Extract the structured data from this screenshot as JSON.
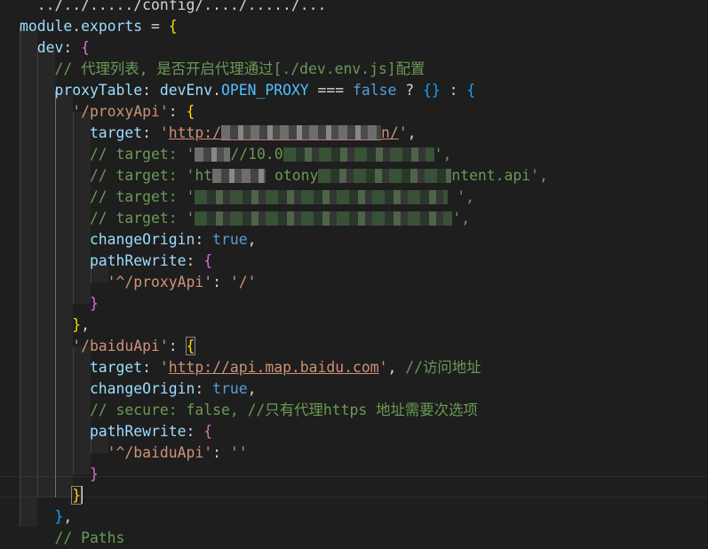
{
  "colors": {
    "keyword": "#569cd6",
    "variable": "#9cdcfe",
    "property": "#9cdcfe",
    "string": "#ce9178",
    "comment": "#6a9955",
    "constant": "#4fc1ff",
    "bracket1": "#ffd700",
    "bracket2": "#da70d6",
    "bracket3": "#179fff",
    "text": "#d4d4d4"
  },
  "lines": [
    {
      "tokens": [
        {
          "t": "  ",
          "c": "text"
        },
        {
          "t": "../../...../config/..../...../...",
          "c": "text"
        }
      ]
    },
    {
      "tokens": [
        {
          "t": "module",
          "c": "variable"
        },
        {
          "t": ".",
          "c": "text"
        },
        {
          "t": "exports",
          "c": "variable"
        },
        {
          "t": " = ",
          "c": "text"
        },
        {
          "t": "{",
          "c": "bracket1"
        }
      ]
    },
    {
      "tokens": [
        {
          "t": "  dev",
          "c": "property"
        },
        {
          "t": ": ",
          "c": "text"
        },
        {
          "t": "{",
          "c": "bracket2"
        }
      ]
    },
    {
      "tokens": [
        {
          "t": "    // 代理列表, 是否开启代理通过[./dev.env.js]配置",
          "c": "comment"
        }
      ]
    },
    {
      "tokens": [
        {
          "t": "    proxyTable",
          "c": "property"
        },
        {
          "t": ": ",
          "c": "text"
        },
        {
          "t": "devEnv",
          "c": "variable"
        },
        {
          "t": ".",
          "c": "text"
        },
        {
          "t": "OPEN_PROXY",
          "c": "constant"
        },
        {
          "t": " === ",
          "c": "text"
        },
        {
          "t": "false",
          "c": "keyword"
        },
        {
          "t": " ? ",
          "c": "text"
        },
        {
          "t": "{}",
          "c": "bracket3"
        },
        {
          "t": " : ",
          "c": "text"
        },
        {
          "t": "{",
          "c": "bracket3"
        }
      ]
    },
    {
      "tokens": [
        {
          "t": "      '/proxyApi'",
          "c": "string"
        },
        {
          "t": ": ",
          "c": "text"
        },
        {
          "t": "{",
          "c": "bracket1"
        }
      ]
    },
    {
      "tokens": [
        {
          "t": "        target",
          "c": "property"
        },
        {
          "t": ": ",
          "c": "text"
        },
        {
          "t": "'",
          "c": "string"
        },
        {
          "t": "http:/",
          "c": "string",
          "u": true
        },
        {
          "blur": 180,
          "k": "light",
          "u": true
        },
        {
          "t": "n/",
          "c": "string",
          "u": true
        },
        {
          "t": "'",
          "c": "string"
        },
        {
          "t": ",",
          "c": "text"
        }
      ]
    },
    {
      "tokens": [
        {
          "t": "        // target: '",
          "c": "comment"
        },
        {
          "blur": 40,
          "k": "light"
        },
        {
          "t": "//10.0",
          "c": "comment"
        },
        {
          "blur": 170,
          "k": "green"
        },
        {
          "t": "',",
          "c": "comment"
        }
      ]
    },
    {
      "tokens": [
        {
          "t": "        // target: 'ht",
          "c": "comment"
        },
        {
          "blur": 60,
          "k": "light"
        },
        {
          "t": " otony",
          "c": "comment"
        },
        {
          "blur": 150,
          "k": "green"
        },
        {
          "t": "ntent.api",
          "c": "comment"
        },
        {
          "t": "',",
          "c": "comment"
        }
      ]
    },
    {
      "tokens": [
        {
          "t": "        // target: '",
          "c": "comment"
        },
        {
          "blur": 285,
          "k": "green"
        },
        {
          "t": " ',",
          "c": "comment"
        }
      ]
    },
    {
      "tokens": [
        {
          "t": "        // target: '",
          "c": "comment"
        },
        {
          "blur": 290,
          "k": "green"
        },
        {
          "t": "',",
          "c": "comment"
        }
      ]
    },
    {
      "tokens": [
        {
          "t": "        changeOrigin",
          "c": "property"
        },
        {
          "t": ": ",
          "c": "text"
        },
        {
          "t": "true",
          "c": "keyword"
        },
        {
          "t": ",",
          "c": "text"
        }
      ]
    },
    {
      "tokens": [
        {
          "t": "        pathRewrite",
          "c": "property"
        },
        {
          "t": ": ",
          "c": "text"
        },
        {
          "t": "{",
          "c": "bracket2"
        }
      ]
    },
    {
      "tokens": [
        {
          "t": "          '^/proxyApi'",
          "c": "string"
        },
        {
          "t": ": ",
          "c": "text"
        },
        {
          "t": "'/'",
          "c": "string"
        }
      ]
    },
    {
      "tokens": [
        {
          "t": "        ",
          "c": "text"
        },
        {
          "t": "}",
          "c": "bracket2"
        }
      ]
    },
    {
      "tokens": [
        {
          "t": "      ",
          "c": "text"
        },
        {
          "t": "}",
          "c": "bracket1"
        },
        {
          "t": ",",
          "c": "text"
        }
      ]
    },
    {
      "tokens": [
        {
          "t": "      '/baiduApi'",
          "c": "string"
        },
        {
          "t": ": ",
          "c": "text"
        },
        {
          "t": "{",
          "c": "bracket1",
          "bm": true
        }
      ]
    },
    {
      "tokens": [
        {
          "t": "        target",
          "c": "property"
        },
        {
          "t": ": ",
          "c": "text"
        },
        {
          "t": "'",
          "c": "string"
        },
        {
          "t": "http://api.map.baidu.com",
          "c": "string",
          "u": true
        },
        {
          "t": "'",
          "c": "string"
        },
        {
          "t": ", ",
          "c": "text"
        },
        {
          "t": "//访问地址",
          "c": "comment"
        }
      ]
    },
    {
      "tokens": [
        {
          "t": "        changeOrigin",
          "c": "property"
        },
        {
          "t": ": ",
          "c": "text"
        },
        {
          "t": "true",
          "c": "keyword"
        },
        {
          "t": ",",
          "c": "text"
        }
      ]
    },
    {
      "tokens": [
        {
          "t": "        // secure: false, //只有代理https 地址需要次选项",
          "c": "comment"
        }
      ]
    },
    {
      "tokens": [
        {
          "t": "        pathRewrite",
          "c": "property"
        },
        {
          "t": ": ",
          "c": "text"
        },
        {
          "t": "{",
          "c": "bracket2"
        }
      ]
    },
    {
      "tokens": [
        {
          "t": "          '^/baiduApi'",
          "c": "string"
        },
        {
          "t": ": ",
          "c": "text"
        },
        {
          "t": "''",
          "c": "string"
        }
      ]
    },
    {
      "tokens": [
        {
          "t": "        ",
          "c": "text"
        },
        {
          "t": "}",
          "c": "bracket2"
        }
      ]
    },
    {
      "tokens": [
        {
          "t": "      ",
          "c": "text"
        },
        {
          "t": "}",
          "c": "bracket1",
          "bm": true
        },
        {
          "cursor": true
        }
      ]
    },
    {
      "tokens": [
        {
          "t": "    ",
          "c": "text"
        },
        {
          "t": "}",
          "c": "bracket3"
        },
        {
          "t": ",",
          "c": "text"
        }
      ]
    },
    {
      "tokens": [
        {
          "t": "    // Paths",
          "c": "comment"
        }
      ]
    }
  ]
}
